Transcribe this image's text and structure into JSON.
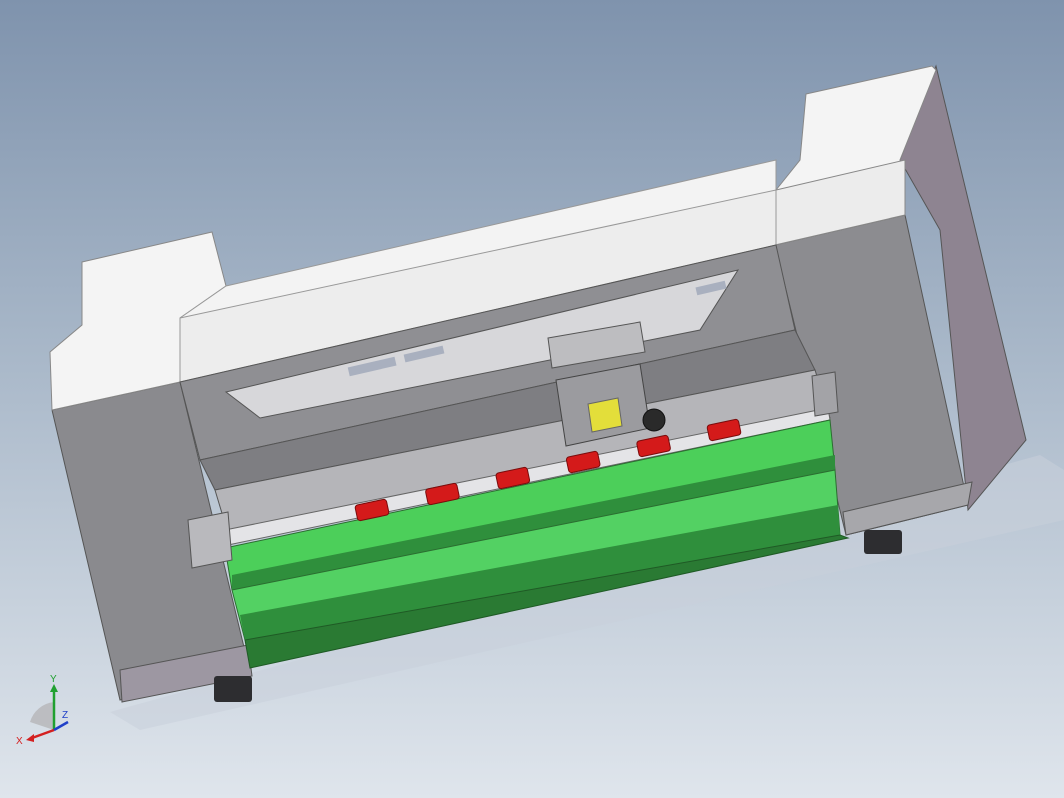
{
  "viewport": {
    "background_top": "#7f93ad",
    "background_bottom": "#dfe5ec"
  },
  "model": {
    "colors": {
      "housing_white": "#f4f4f4",
      "housing_edge": "#b7b7bb",
      "frame_gray": "#8a8a8e",
      "side_dark": "#6f6873",
      "rail_gray": "#c9c9cc",
      "platen_green": "#4ccf5a",
      "platen_dark": "#2f8f3c",
      "roller_red": "#d41a1a",
      "head_yellow": "#e3de3a",
      "foot_dark": "#2d2d30"
    },
    "roller_count": 6
  },
  "triad": {
    "x_label": "X",
    "y_label": "Y",
    "z_label": "Z",
    "x_color": "#d42020",
    "y_color": "#20a030",
    "z_color": "#2040c8"
  }
}
